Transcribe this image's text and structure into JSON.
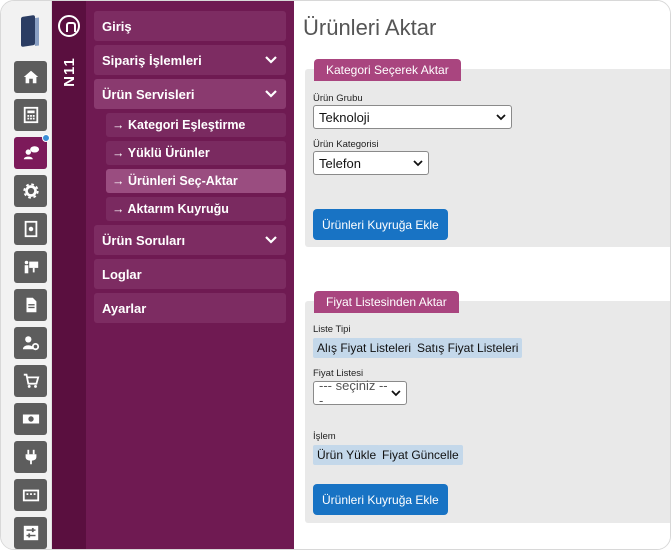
{
  "nav": {
    "brand": "N11",
    "items": [
      {
        "label": "Giriş"
      },
      {
        "label": "Sipariş İşlemleri"
      },
      {
        "label": "Ürün Servisleri"
      },
      {
        "label": "Ürün Soruları"
      },
      {
        "label": "Loglar"
      },
      {
        "label": "Ayarlar"
      }
    ],
    "subitems": [
      {
        "label": "→ Kategori Eşleştirme"
      },
      {
        "label": "→ Yüklü Ürünler"
      },
      {
        "label": "→ Ürünleri Seç-Aktar"
      },
      {
        "label": "→ Aktarım Kuyruğu"
      }
    ]
  },
  "rail_icons": [
    "home-icon",
    "calculator-icon",
    "chat-user-icon",
    "gear-icon",
    "book-icon",
    "presentation-icon",
    "file-icon",
    "user-cog-icon",
    "cart-icon",
    "money-icon",
    "plug-icon",
    "keyboard-icon",
    "sliders-icon"
  ],
  "page": {
    "title": "Ürünleri Aktar",
    "category_panel": {
      "tab": "Kategori Seçerek Aktar",
      "group_label": "Ürün Grubu",
      "group_value": "Teknoloji",
      "category_label": "Ürün Kategorisi",
      "category_value": "Telefon",
      "button": "Ürünleri Kuyruğa Ekle"
    },
    "price_panel": {
      "tab": "Fiyat Listesinden Aktar",
      "list_type_label": "Liste Tipi",
      "list_type_options": [
        "Alış Fiyat Listeleri",
        "Satış Fiyat Listeleri"
      ],
      "price_list_label": "Fiyat Listesi",
      "price_list_value": "--- seçiniz ---",
      "action_label": "İşlem",
      "action_options": [
        "Ürün Yükle",
        "Fiyat Güncelle"
      ],
      "button": "Ürünleri Kuyruğa Ekle"
    }
  },
  "colors": {
    "menu": "#6f1a52",
    "strip": "#5a0f3f",
    "tab": "#a9457f",
    "button": "#1873c4"
  }
}
